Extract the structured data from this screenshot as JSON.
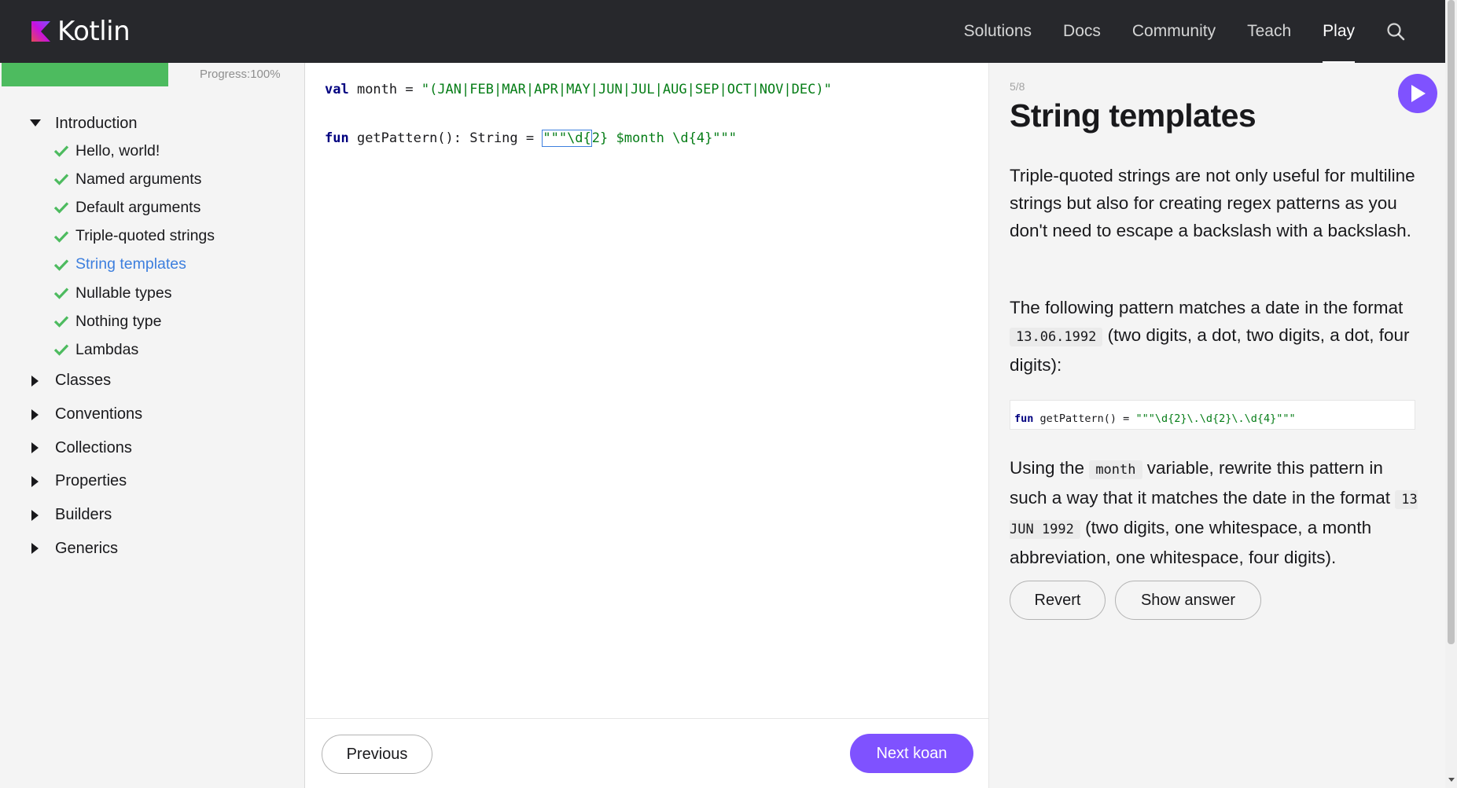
{
  "header": {
    "logo_text": "Kotlin",
    "nav": [
      {
        "label": "Solutions",
        "active": false
      },
      {
        "label": "Docs",
        "active": false
      },
      {
        "label": "Community",
        "active": false
      },
      {
        "label": "Teach",
        "active": false
      },
      {
        "label": "Play",
        "active": true
      }
    ],
    "search_icon": "search-icon"
  },
  "sidebar": {
    "progress": {
      "value": 1.0,
      "label": "Progress:100%",
      "color": "#4dbb5f"
    },
    "sections": [
      {
        "label": "Introduction",
        "expanded": true,
        "items": [
          {
            "label": "Hello, world!",
            "done": true,
            "current": false
          },
          {
            "label": "Named arguments",
            "done": true,
            "current": false
          },
          {
            "label": "Default arguments",
            "done": true,
            "current": false
          },
          {
            "label": "Triple-quoted strings",
            "done": true,
            "current": false
          },
          {
            "label": "String templates",
            "done": true,
            "current": true
          },
          {
            "label": "Nullable types",
            "done": true,
            "current": false
          },
          {
            "label": "Nothing type",
            "done": true,
            "current": false
          },
          {
            "label": "Lambdas",
            "done": true,
            "current": false
          }
        ]
      },
      {
        "label": "Classes",
        "expanded": false
      },
      {
        "label": "Conventions",
        "expanded": false
      },
      {
        "label": "Collections",
        "expanded": false
      },
      {
        "label": "Properties",
        "expanded": false
      },
      {
        "label": "Builders",
        "expanded": false
      },
      {
        "label": "Generics",
        "expanded": false
      }
    ]
  },
  "editor": {
    "line1": {
      "kw": "val",
      "name": " month = ",
      "str": "\"(JAN|FEB|MAR|APR|MAY|JUN|JUL|AUG|SEP|OCT|NOV|DEC)\""
    },
    "line2": {
      "kw": "fun",
      "sig": " getPattern(): String = ",
      "sel": "\"\"\"\\d{",
      "rest_str": "2} $month \\d{4}\"\"\""
    },
    "previous_label": "Previous",
    "next_label": "Next koan"
  },
  "task": {
    "step": "5/8",
    "title": "String templates",
    "p1": "Triple-quoted strings are not only useful for multiline strings but also for creating regex patterns as you don't need to escape a backslash with a backslash.",
    "p2_a": "The following pattern matches a date in the format ",
    "p2_code": "13.06.1992",
    "p2_b": " (two digits, a dot, two digits, a dot, four digits):",
    "snippet_kw": "fun",
    "snippet_sig": " getPattern() = ",
    "snippet_str": "\"\"\"\\d{2}\\.\\d{2}\\.\\d{4}\"\"\"",
    "p3_a": "Using the ",
    "p3_code1": "month",
    "p3_b": " variable, rewrite this pattern in such a way that it matches the date in the format ",
    "p3_code2": "13 JUN 1992",
    "p3_c": " (two digits, one whitespace, a month abbreviation, one whitespace, four digits).",
    "revert_label": "Revert",
    "show_answer_label": "Show answer",
    "accent": "#7f52ff"
  }
}
